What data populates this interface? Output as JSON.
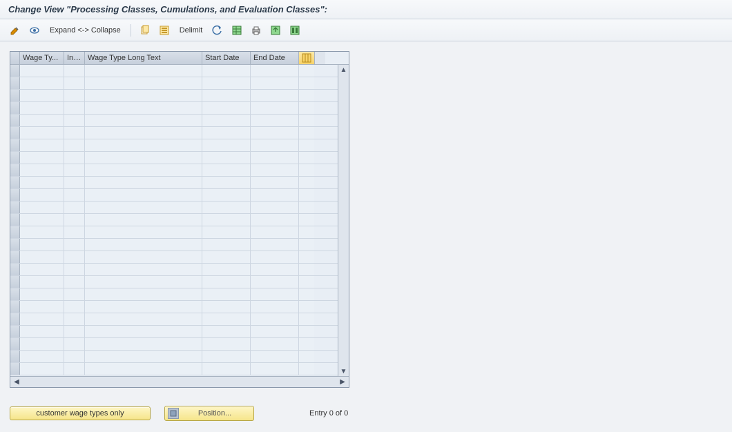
{
  "title": "Change View \"Processing Classes, Cumulations, and Evaluation Classes\":",
  "toolbar": {
    "expand_collapse": "Expand <-> Collapse",
    "delimit": "Delimit"
  },
  "table": {
    "columns": {
      "wage_type": "Wage Ty...",
      "inf": "Inf...",
      "long_text": "Wage Type Long Text",
      "start_date": "Start Date",
      "end_date": "End Date"
    },
    "row_count": 25
  },
  "footer": {
    "customer_btn": "customer wage types only",
    "position_btn": "Position...",
    "entry_info": "Entry 0 of 0"
  }
}
